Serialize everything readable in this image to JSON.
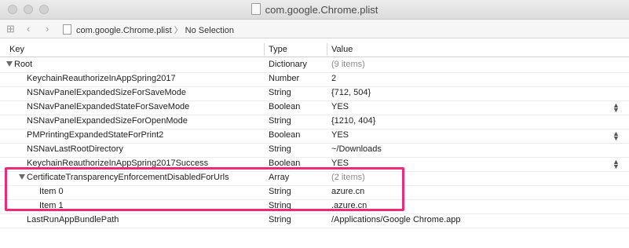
{
  "window": {
    "title": "com.google.Chrome.plist"
  },
  "toolbar": {
    "crumb_file": "com.google.Chrome.plist",
    "crumb_selection": "No Selection",
    "separator": "〉"
  },
  "columns": {
    "key": "Key",
    "type": "Type",
    "value": "Value"
  },
  "rows": [
    {
      "key": "Root",
      "type": "Dictionary",
      "value": "(9 items)"
    },
    {
      "key": "KeychainReauthorizeInAppSpring2017",
      "type": "Number",
      "value": "2"
    },
    {
      "key": "NSNavPanelExpandedSizeForSaveMode",
      "type": "String",
      "value": "{712, 504}"
    },
    {
      "key": "NSNavPanelExpandedStateForSaveMode",
      "type": "Boolean",
      "value": "YES"
    },
    {
      "key": "NSNavPanelExpandedSizeForOpenMode",
      "type": "String",
      "value": "{1210, 404}"
    },
    {
      "key": "PMPrintingExpandedStateForPrint2",
      "type": "Boolean",
      "value": "YES"
    },
    {
      "key": "NSNavLastRootDirectory",
      "type": "String",
      "value": "~/Downloads"
    },
    {
      "key": "KeychainReauthorizeInAppSpring2017Success",
      "type": "Boolean",
      "value": "YES"
    },
    {
      "key": "CertificateTransparencyEnforcementDisabledForUrls",
      "type": "Array",
      "value": "(2 items)"
    },
    {
      "key": "Item 0",
      "type": "String",
      "value": "azure.cn"
    },
    {
      "key": "Item 1",
      "type": "String",
      "value": ".azure.cn"
    },
    {
      "key": "LastRunAppBundlePath",
      "type": "String",
      "value": "/Applications/Google Chrome.app"
    }
  ],
  "annotation": {
    "color": "#ee2a76"
  }
}
